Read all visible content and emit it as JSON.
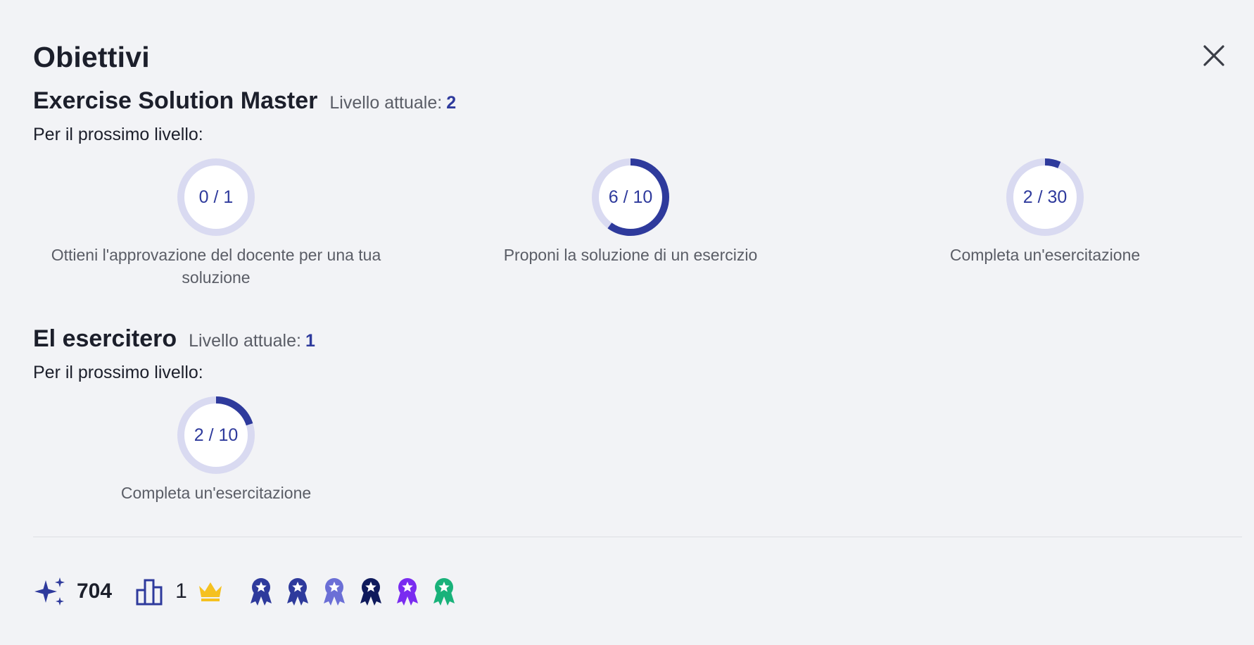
{
  "dialog": {
    "title": "Obiettivi",
    "close_label": "close"
  },
  "sections": [
    {
      "name": "Exercise Solution Master",
      "level_label": "Livello attuale:",
      "level_value": "2",
      "next_label": "Per il prossimo livello:",
      "goals": [
        {
          "progress_text": "0 / 1",
          "current": 0,
          "target": 1,
          "description": "Ottieni l'approvazione del docente per una tua soluzione"
        },
        {
          "progress_text": "6 / 10",
          "current": 6,
          "target": 10,
          "description": "Proponi la soluzione di un esercizio"
        },
        {
          "progress_text": "2 / 30",
          "current": 2,
          "target": 30,
          "description": "Completa un'esercitazione"
        }
      ]
    },
    {
      "name": "El esercitero",
      "level_label": "Livello attuale:",
      "level_value": "1",
      "next_label": "Per il prossimo livello:",
      "goals": [
        {
          "progress_text": "2 / 10",
          "current": 2,
          "target": 10,
          "description": "Completa un'esercitazione"
        }
      ]
    }
  ],
  "footer": {
    "points": "704",
    "rank": "1",
    "icons": {
      "points": "sparkles-icon",
      "rank": "podium-icon",
      "crown": "crown-icon"
    },
    "badges": [
      {
        "icon": "ribbon-badge-icon",
        "color": "#2e3a9c"
      },
      {
        "icon": "ribbon-badge-icon",
        "color": "#2e3a9c"
      },
      {
        "icon": "ribbon-badge-icon",
        "color": "#6b6fd6"
      },
      {
        "icon": "ribbon-badge-icon",
        "color": "#0f1a5c"
      },
      {
        "icon": "ribbon-badge-icon",
        "color": "#7a2cf0"
      },
      {
        "icon": "ribbon-badge-icon",
        "color": "#19b27a"
      }
    ]
  },
  "colors": {
    "accent": "#2e3a9c",
    "ring_track": "#d9daf1",
    "crown": "#f5c120"
  }
}
